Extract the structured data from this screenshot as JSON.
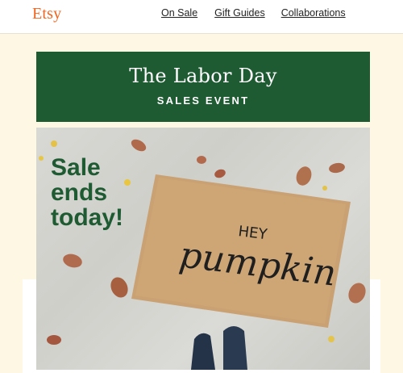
{
  "header": {
    "logo": "Etsy",
    "nav": [
      "On Sale",
      "Gift Guides",
      "Collaborations"
    ]
  },
  "banner": {
    "title": "The Labor Day",
    "subtitle": "SALES EVENT"
  },
  "hero": {
    "headline": [
      "Sale",
      "ends",
      "today!"
    ],
    "mat_text_small": "HEY",
    "mat_text_large": "pumpkin"
  },
  "colors": {
    "brand": "#f1641e",
    "banner_green": "#1e5a32",
    "page_bg": "#fdf7e4"
  }
}
